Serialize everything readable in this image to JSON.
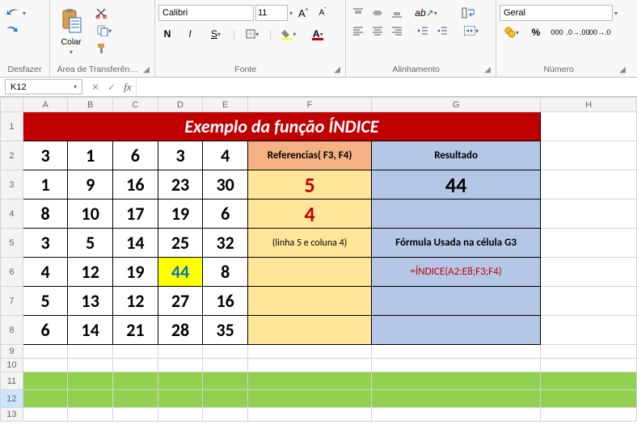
{
  "ribbon": {
    "undo": {
      "label": "Desfazer"
    },
    "clipboard": {
      "label": "Área de Transferên…",
      "paste": "Colar"
    },
    "font": {
      "label": "Fonte",
      "name": "Calibri",
      "size": "11"
    },
    "alignment": {
      "label": "Alinhamento"
    },
    "number": {
      "label": "Número",
      "format": "Geral"
    }
  },
  "nameBox": "K12",
  "formula": "",
  "columns": [
    "A",
    "B",
    "C",
    "D",
    "E",
    "F",
    "G",
    "H"
  ],
  "title": "Exemplo da função ÍNDICE",
  "rows": [
    {
      "cells": [
        "3",
        "1",
        "6",
        "3",
        "4"
      ],
      "f": "Referencias( F3, F4)",
      "g": "Resultado"
    },
    {
      "cells": [
        "1",
        "9",
        "16",
        "23",
        "30"
      ],
      "f": "5",
      "g": "44"
    },
    {
      "cells": [
        "8",
        "10",
        "17",
        "19",
        "6"
      ],
      "f": "4",
      "g": ""
    },
    {
      "cells": [
        "3",
        "5",
        "14",
        "25",
        "32"
      ],
      "f": "(linha 5 e coluna 4)",
      "g": "Fórmula Usada na célula G3"
    },
    {
      "cells": [
        "4",
        "12",
        "19",
        "44",
        "8"
      ],
      "f": "",
      "g": "=ÍNDICE(A2:E8;F3;F4)"
    },
    {
      "cells": [
        "5",
        "13",
        "12",
        "27",
        "16"
      ],
      "f": "",
      "g": ""
    },
    {
      "cells": [
        "6",
        "14",
        "21",
        "28",
        "35"
      ],
      "f": "",
      "g": ""
    }
  ],
  "rowHeights": {
    "dataStart": 2,
    "emptyRows": [
      9,
      10
    ],
    "greenRows": [
      11,
      12
    ],
    "tailRows": [
      13
    ]
  },
  "chart_data": {
    "type": "table",
    "title": "Exemplo da função ÍNDICE",
    "columns": [
      "A",
      "B",
      "C",
      "D",
      "E"
    ],
    "data": [
      [
        3,
        1,
        6,
        3,
        4
      ],
      [
        1,
        9,
        16,
        23,
        30
      ],
      [
        8,
        10,
        17,
        19,
        6
      ],
      [
        3,
        5,
        14,
        25,
        32
      ],
      [
        4,
        12,
        19,
        44,
        8
      ],
      [
        5,
        13,
        12,
        27,
        16
      ],
      [
        6,
        14,
        21,
        28,
        35
      ]
    ],
    "references": {
      "F3": 5,
      "F4": 4,
      "note": "(linha 5 e coluna 4)"
    },
    "result": {
      "value": 44,
      "formula": "=ÍNDICE(A2:E8;F3;F4)"
    }
  }
}
